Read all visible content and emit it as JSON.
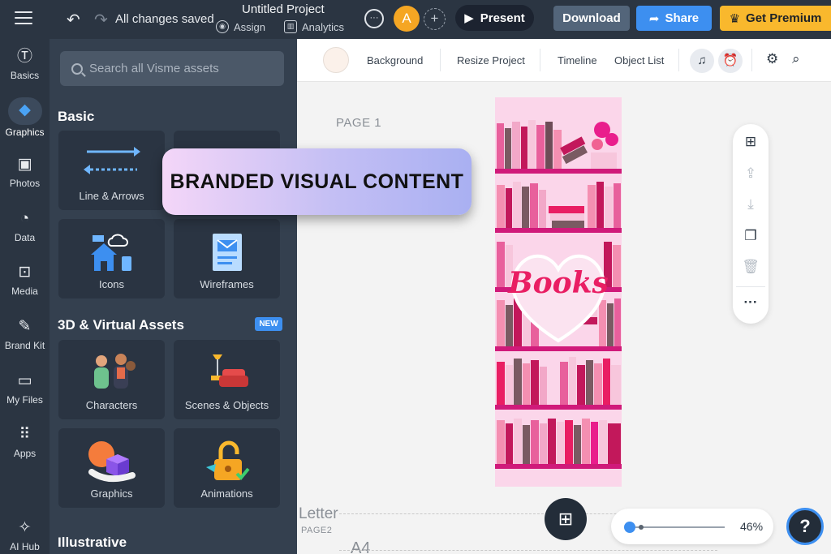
{
  "topbar": {
    "saved_status": "All changes saved",
    "project_title": "Untitled Project",
    "assign_label": "Assign",
    "analytics_label": "Analytics",
    "avatar_initial": "A",
    "present_label": "Present",
    "download_label": "Download",
    "share_label": "Share",
    "premium_label": "Get Premium"
  },
  "rail": {
    "items": [
      {
        "label": "Basics",
        "icon": "text-icon"
      },
      {
        "label": "Graphics",
        "icon": "shapes-icon"
      },
      {
        "label": "Photos",
        "icon": "photo-icon"
      },
      {
        "label": "Data",
        "icon": "pie-chart-icon"
      },
      {
        "label": "Media",
        "icon": "video-icon"
      },
      {
        "label": "Brand Kit",
        "icon": "brand-kit-icon"
      },
      {
        "label": "My Files",
        "icon": "folder-icon"
      },
      {
        "label": "Apps",
        "icon": "apps-grid-icon"
      },
      {
        "label": "AI Hub",
        "icon": "sparkle-icon"
      }
    ]
  },
  "panel": {
    "search_placeholder": "Search all Visme assets",
    "section_basic": "Basic",
    "section_3d": "3D & Virtual Assets",
    "new_badge": "NEW",
    "section_illustrative": "Illustrative",
    "tiles": [
      {
        "label": "Line & Arrows"
      },
      {
        "label": "Icons"
      },
      {
        "label": "Wireframes"
      },
      {
        "label": "Characters"
      },
      {
        "label": "Scenes & Objects"
      },
      {
        "label": "Graphics"
      },
      {
        "label": "Animations"
      }
    ]
  },
  "banner": {
    "text": "BRANDED VISUAL CONTENT"
  },
  "canvas_toolbar": {
    "background": "Background",
    "resize": "Resize Project",
    "timeline": "Timeline",
    "object_list": "Object List"
  },
  "canvas": {
    "page1_label": "PAGE 1",
    "design_word": "Books",
    "letter_label": "Letter",
    "page2_label": "PAGE2",
    "a4_label": "A4",
    "zoom_value": "46%",
    "help_label": "?"
  },
  "colors": {
    "accent": "#3d8ff0",
    "premium": "#f9b82d",
    "rail_bg": "#2b3542",
    "panel_bg": "#34404f"
  }
}
